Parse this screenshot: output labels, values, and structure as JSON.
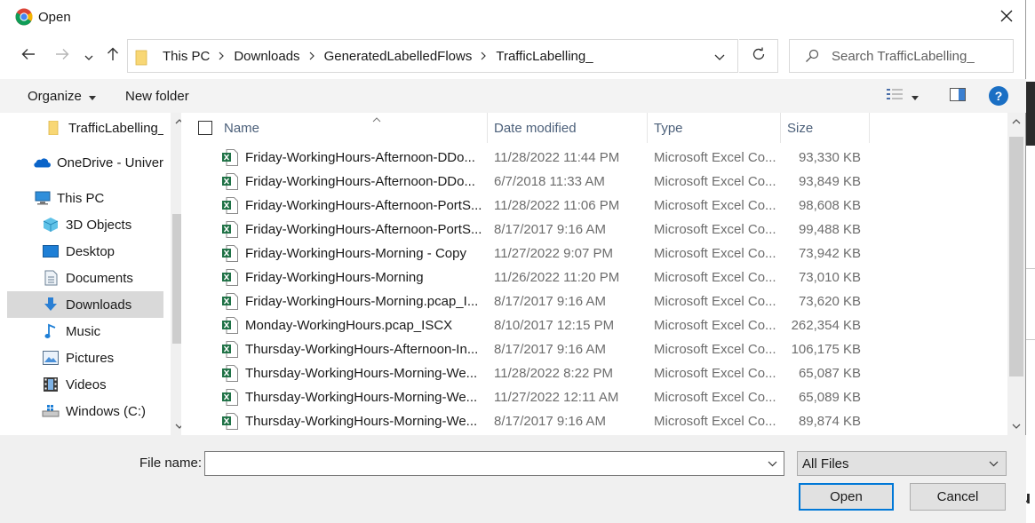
{
  "window": {
    "title": "Open",
    "app_icon": "chrome-icon",
    "close_icon": "close-icon"
  },
  "navigation": {
    "back_icon": "back-arrow-icon",
    "forward_icon": "forward-arrow-icon",
    "recent_icon": "chevron-down-icon",
    "up_icon": "up-arrow-icon",
    "breadcrumbs": [
      "This PC",
      "Downloads",
      "GeneratedLabelledFlows",
      "TrafficLabelling_"
    ],
    "refresh_icon": "refresh-icon",
    "search_placeholder": "Search TrafficLabelling_"
  },
  "commandbar": {
    "organize_label": "Organize",
    "new_folder_label": "New folder",
    "view_icon": "details-view-icon",
    "preview_icon": "preview-pane-icon",
    "help_label": "?"
  },
  "sidebar": {
    "items": [
      {
        "label": "TrafficLabelling_",
        "icon": "folder-icon"
      },
      {
        "label": "OneDrive - Univer",
        "icon": "onedrive-icon"
      },
      {
        "label": "This PC",
        "icon": "computer-icon"
      },
      {
        "label": "3D Objects",
        "icon": "3d-objects-icon"
      },
      {
        "label": "Desktop",
        "icon": "desktop-icon"
      },
      {
        "label": "Documents",
        "icon": "documents-icon"
      },
      {
        "label": "Downloads",
        "icon": "downloads-icon",
        "selected": true
      },
      {
        "label": "Music",
        "icon": "music-icon"
      },
      {
        "label": "Pictures",
        "icon": "pictures-icon"
      },
      {
        "label": "Videos",
        "icon": "videos-icon"
      },
      {
        "label": "Windows (C:)",
        "icon": "drive-icon"
      }
    ]
  },
  "filelist": {
    "columns": {
      "name": "Name",
      "date": "Date modified",
      "type": "Type",
      "size": "Size"
    },
    "files": [
      {
        "name": "Friday-WorkingHours-Afternoon-DDo...",
        "date": "11/28/2022 11:44 PM",
        "type": "Microsoft Excel Co...",
        "size": "93,330 KB"
      },
      {
        "name": "Friday-WorkingHours-Afternoon-DDo...",
        "date": "6/7/2018 11:33 AM",
        "type": "Microsoft Excel Co...",
        "size": "93,849 KB"
      },
      {
        "name": "Friday-WorkingHours-Afternoon-PortS...",
        "date": "11/28/2022 11:06 PM",
        "type": "Microsoft Excel Co...",
        "size": "98,608 KB"
      },
      {
        "name": "Friday-WorkingHours-Afternoon-PortS...",
        "date": "8/17/2017 9:16 AM",
        "type": "Microsoft Excel Co...",
        "size": "99,488 KB"
      },
      {
        "name": "Friday-WorkingHours-Morning - Copy",
        "date": "11/27/2022 9:07 PM",
        "type": "Microsoft Excel Co...",
        "size": "73,942 KB"
      },
      {
        "name": "Friday-WorkingHours-Morning",
        "date": "11/26/2022 11:20 PM",
        "type": "Microsoft Excel Co...",
        "size": "73,010 KB"
      },
      {
        "name": "Friday-WorkingHours-Morning.pcap_I...",
        "date": "8/17/2017 9:16 AM",
        "type": "Microsoft Excel Co...",
        "size": "73,620 KB"
      },
      {
        "name": "Monday-WorkingHours.pcap_ISCX",
        "date": "8/10/2017 12:15 PM",
        "type": "Microsoft Excel Co...",
        "size": "262,354 KB"
      },
      {
        "name": "Thursday-WorkingHours-Afternoon-In...",
        "date": "8/17/2017 9:16 AM",
        "type": "Microsoft Excel Co...",
        "size": "106,175 KB"
      },
      {
        "name": "Thursday-WorkingHours-Morning-We...",
        "date": "11/28/2022 8:22 PM",
        "type": "Microsoft Excel Co...",
        "size": "65,087 KB"
      },
      {
        "name": "Thursday-WorkingHours-Morning-We...",
        "date": "11/27/2022 12:11 AM",
        "type": "Microsoft Excel Co...",
        "size": "65,089 KB"
      },
      {
        "name": "Thursday-WorkingHours-Morning-We...",
        "date": "8/17/2017 9:16 AM",
        "type": "Microsoft Excel Co...",
        "size": "89,874 KB"
      }
    ]
  },
  "bottom": {
    "file_name_label": "File name:",
    "file_name_value": "",
    "filter_value": "All Files",
    "open_label": "Open",
    "cancel_label": "Cancel"
  },
  "colors": {
    "accent": "#0078d7",
    "header_text": "#4c607a",
    "excel_green": "#1e7145",
    "folder_yellow": "#f8d775"
  }
}
